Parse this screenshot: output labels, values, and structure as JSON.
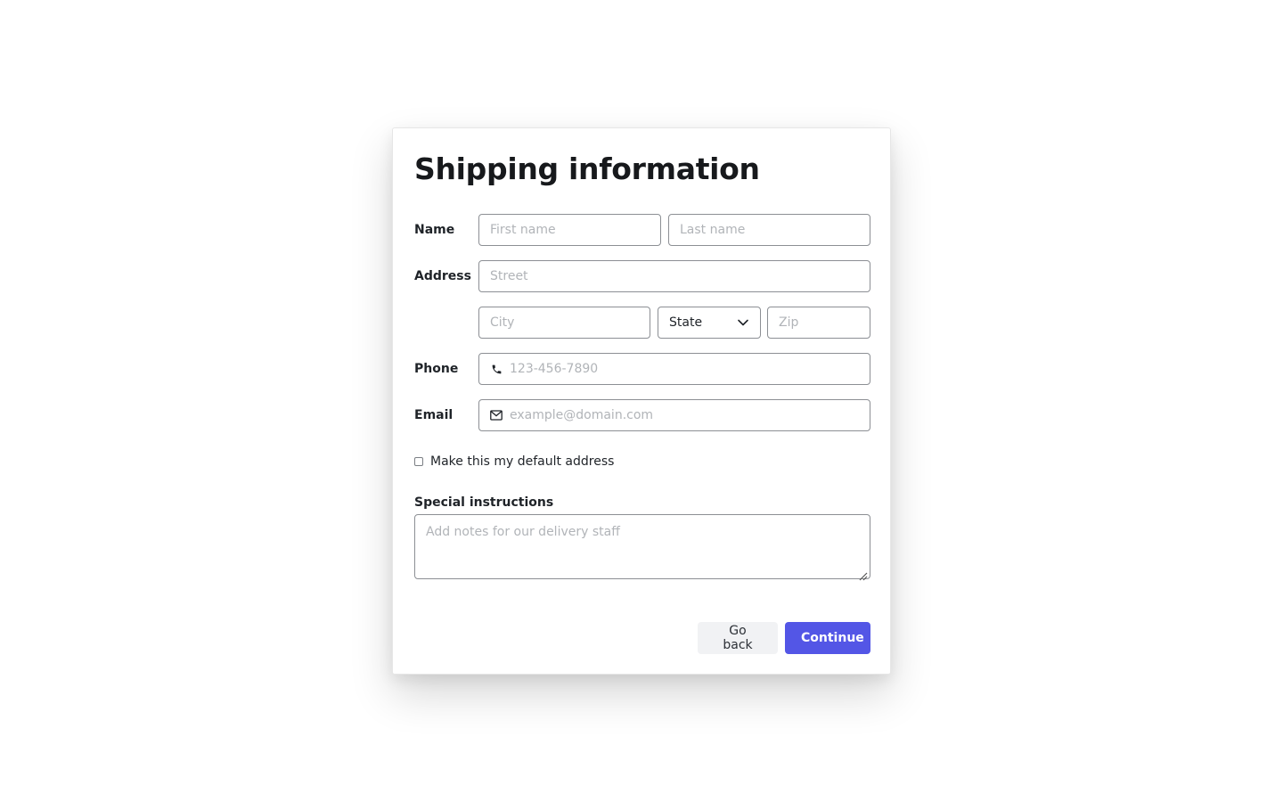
{
  "form": {
    "title": "Shipping information",
    "labels": {
      "name": "Name",
      "address": "Address",
      "phone": "Phone",
      "email": "Email",
      "special_instructions": "Special instructions"
    },
    "placeholders": {
      "first_name": "First name",
      "last_name": "Last name",
      "street": "Street",
      "city": "City",
      "zip": "Zip",
      "phone": "123-456-7890",
      "email": "example@domain.com",
      "notes": "Add notes for our delivery staff"
    },
    "state_select": {
      "selected": "State"
    },
    "default_address_label": "Make this my default address"
  },
  "buttons": {
    "go_back": "Go back",
    "continue": "Continue"
  },
  "icons": {
    "phone": "phone-icon",
    "email": "mail-icon",
    "chevron": "chevron-down-icon",
    "resize": "resize-handle-icon"
  },
  "colors": {
    "primary": "#5356e6",
    "secondary_bg": "#f1f2f4",
    "border": "#8c8f94",
    "placeholder": "#b1b4b8",
    "text": "#1f2328"
  }
}
